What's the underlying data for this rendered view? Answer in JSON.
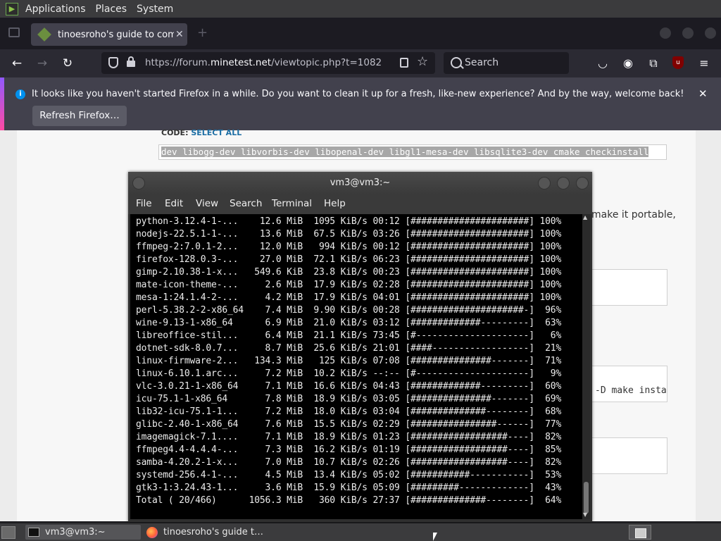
{
  "panel": {
    "menus": [
      "Applications",
      "Places",
      "System"
    ]
  },
  "firefox": {
    "tab_title": "tinoesroho's guide to comp",
    "url_prefix": "https://forum.",
    "url_host": "minetest.net",
    "url_path": "/viewtopic.php?t=1082",
    "search_placeholder": "Search",
    "notification": "It looks like you haven't started Firefox in a while. Do you want to clean it up for a fresh, like-new experience? And by the way, welcome back!",
    "refresh_button": "Refresh Firefox…"
  },
  "page": {
    "code_label": "CODE:",
    "select_all": "SELECT ALL",
    "code_text": "dev libogg-dev libvorbis-dev libopenal-dev libgl1-mesa-dev libsqlite3-dev cmake checkinstall",
    "portable_text": "make it portable,",
    "make_text": "-D make insta"
  },
  "terminal": {
    "title": "vm3@vm3:~",
    "menus": [
      "File",
      "Edit",
      "View",
      "Search",
      "Terminal",
      "Help"
    ],
    "lines": [
      "python-3.12.4-1-...    12.6 MiB  1095 KiB/s 00:12 [######################] 100%",
      "nodejs-22.5.1-1-...    13.6 MiB  67.5 KiB/s 03:26 [######################] 100%",
      "ffmpeg-2:7.0.1-2...    12.0 MiB   994 KiB/s 00:12 [######################] 100%",
      "firefox-128.0.3-...    27.0 MiB  72.1 KiB/s 06:23 [######################] 100%",
      "gimp-2.10.38-1-x...   549.6 KiB  23.8 KiB/s 00:23 [######################] 100%",
      "mate-icon-theme-...     2.6 MiB  17.9 KiB/s 02:28 [######################] 100%",
      "mesa-1:24.1.4-2-...     4.2 MiB  17.9 KiB/s 04:01 [######################] 100%",
      "perl-5.38.2-2-x86_64    7.4 MiB  9.90 KiB/s 00:28 [#####################-]  96%",
      "wine-9.13-1-x86_64      6.9 MiB  21.0 KiB/s 03:12 [#############---------]  63%",
      "libreoffice-stil...     6.4 MiB  21.1 KiB/s 73:45 [#---------------------]   6%",
      "dotnet-sdk-8.0.7...     8.7 MiB  25.6 KiB/s 21:01 [####------------------]  21%",
      "linux-firmware-2...   134.3 MiB   125 KiB/s 07:08 [###############-------]  71%",
      "linux-6.10.1.arc...     7.2 MiB  10.2 KiB/s --:-- [#---------------------]   9%",
      "vlc-3.0.21-1-x86_64     7.1 MiB  16.6 KiB/s 04:43 [#############---------]  60%",
      "icu-75.1-1-x86_64       7.8 MiB  18.9 KiB/s 03:05 [###############-------]  69%",
      "lib32-icu-75.1-1...     7.2 MiB  18.0 KiB/s 03:04 [##############--------]  68%",
      "glibc-2.40-1-x86_64     7.6 MiB  15.5 KiB/s 02:29 [################------]  77%",
      "imagemagick-7.1....     7.1 MiB  18.9 KiB/s 01:23 [##################----]  82%",
      "ffmpeg4.4-4.4.4-...     7.3 MiB  16.2 KiB/s 01:19 [##################----]  85%",
      "samba-4.20.2-1-x...     7.0 MiB  10.7 KiB/s 02:26 [##################----]  82%",
      "systemd-256.4-1-...     4.5 MiB  13.4 KiB/s 05:02 [###########-----------]  53%",
      "gtk3-1:3.24.43-1...     3.6 MiB  15.9 KiB/s 05:09 [#########-------------]  43%",
      "Total ( 20/466)      1056.3 MiB   360 KiB/s 27:37 [##############--------]  64%"
    ]
  },
  "taskbar": {
    "items": [
      "vm3@vm3:~",
      "tinoesroho's guide t…"
    ]
  }
}
